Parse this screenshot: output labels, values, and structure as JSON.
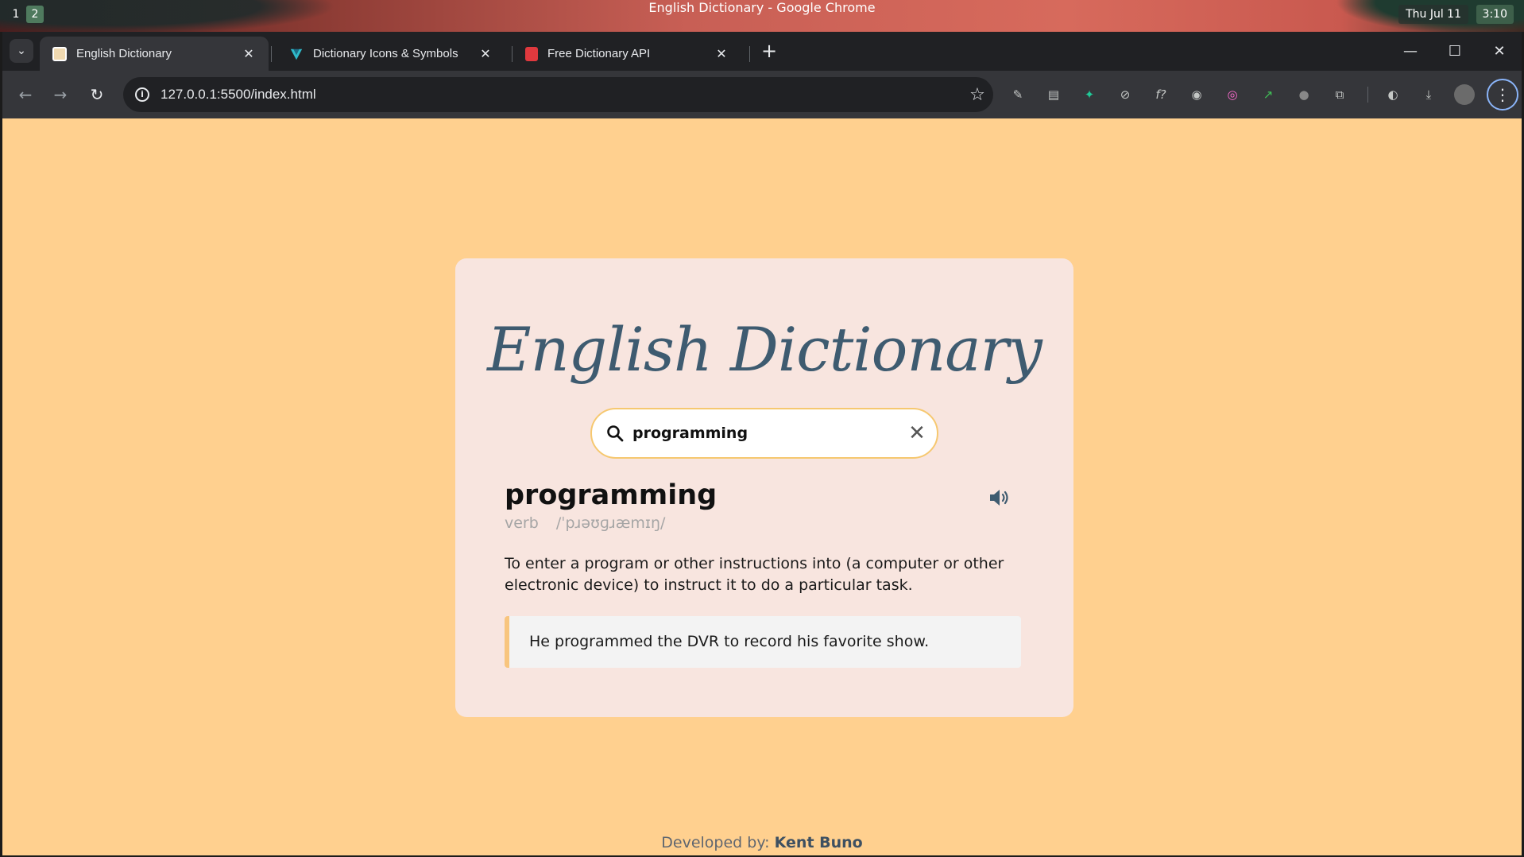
{
  "desktop": {
    "workspaces": [
      "1",
      "2"
    ],
    "window_title": "English Dictionary - Google Chrome",
    "date": "Thu Jul 11",
    "time": "3:10"
  },
  "browser": {
    "tabs": [
      {
        "label": "English Dictionary",
        "icon": "dictionary-favicon",
        "active": true
      },
      {
        "label": "Dictionary Icons & Symbols",
        "icon": "vuetify-favicon",
        "active": false
      },
      {
        "label": "Free Dictionary API",
        "icon": "bookmark-favicon",
        "active": false
      }
    ],
    "url": "127.0.0.1:5500/index.html",
    "colors": {
      "tabstrip": "#202124",
      "toolbar": "#35363a",
      "accent": "#8ab4f8"
    }
  },
  "app": {
    "title": "English Dictionary",
    "search_value": "programming",
    "result": {
      "word": "programming",
      "part_of_speech": "verb",
      "phonetic": "/ˈpɹəʊɡɹæmɪŋ/",
      "definition": "To enter a program or other instructions into (a computer or other electronic device) to instruct it to do a particular task.",
      "example": "He programmed the DVR to record his favorite show."
    },
    "footer": {
      "prefix": "Developed by:",
      "author": "Kent Buno"
    },
    "colors": {
      "background": "#ffd08f",
      "card": "#f8e5df",
      "title": "#3e5b70",
      "accent": "#f8c57e"
    }
  }
}
